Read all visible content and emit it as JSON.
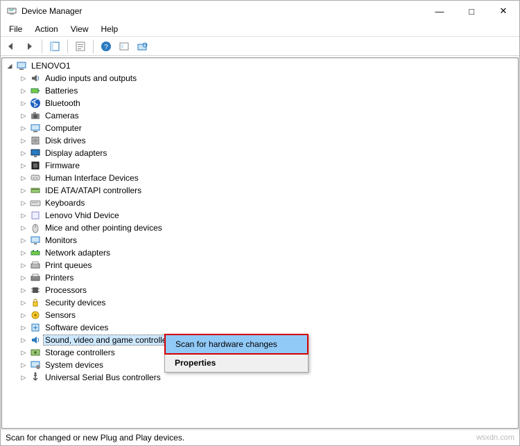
{
  "window": {
    "title": "Device Manager"
  },
  "menu": {
    "items": [
      "File",
      "Action",
      "View",
      "Help"
    ]
  },
  "toolbar": {
    "icons": [
      "back",
      "forward",
      "up-container",
      "properties",
      "help",
      "show-hidden",
      "scan"
    ]
  },
  "tree": {
    "root": {
      "label": "LENOVO1",
      "icon": "computer"
    },
    "children": [
      {
        "label": "Audio inputs and outputs",
        "icon": "audio"
      },
      {
        "label": "Batteries",
        "icon": "battery"
      },
      {
        "label": "Bluetooth",
        "icon": "bluetooth"
      },
      {
        "label": "Cameras",
        "icon": "camera"
      },
      {
        "label": "Computer",
        "icon": "computer"
      },
      {
        "label": "Disk drives",
        "icon": "disk"
      },
      {
        "label": "Display adapters",
        "icon": "display"
      },
      {
        "label": "Firmware",
        "icon": "firmware"
      },
      {
        "label": "Human Interface Devices",
        "icon": "hid"
      },
      {
        "label": "IDE ATA/ATAPI controllers",
        "icon": "ide"
      },
      {
        "label": "Keyboards",
        "icon": "keyboard"
      },
      {
        "label": "Lenovo Vhid Device",
        "icon": "vhid"
      },
      {
        "label": "Mice and other pointing devices",
        "icon": "mouse"
      },
      {
        "label": "Monitors",
        "icon": "monitor"
      },
      {
        "label": "Network adapters",
        "icon": "network"
      },
      {
        "label": "Print queues",
        "icon": "printqueue"
      },
      {
        "label": "Printers",
        "icon": "printer"
      },
      {
        "label": "Processors",
        "icon": "cpu"
      },
      {
        "label": "Security devices",
        "icon": "security"
      },
      {
        "label": "Sensors",
        "icon": "sensor"
      },
      {
        "label": "Software devices",
        "icon": "software"
      },
      {
        "label": "Sound, video and game controllers",
        "icon": "sound",
        "selected": true
      },
      {
        "label": "Storage controllers",
        "icon": "storage"
      },
      {
        "label": "System devices",
        "icon": "system"
      },
      {
        "label": "Universal Serial Bus controllers",
        "icon": "usb"
      }
    ]
  },
  "context_menu": {
    "items": [
      {
        "label": "Scan for hardware changes",
        "highlight": true
      },
      {
        "label": "Properties",
        "bold": true
      }
    ]
  },
  "status": {
    "text": "Scan for changed or new Plug and Play devices."
  },
  "watermark": "wsxdn.com"
}
